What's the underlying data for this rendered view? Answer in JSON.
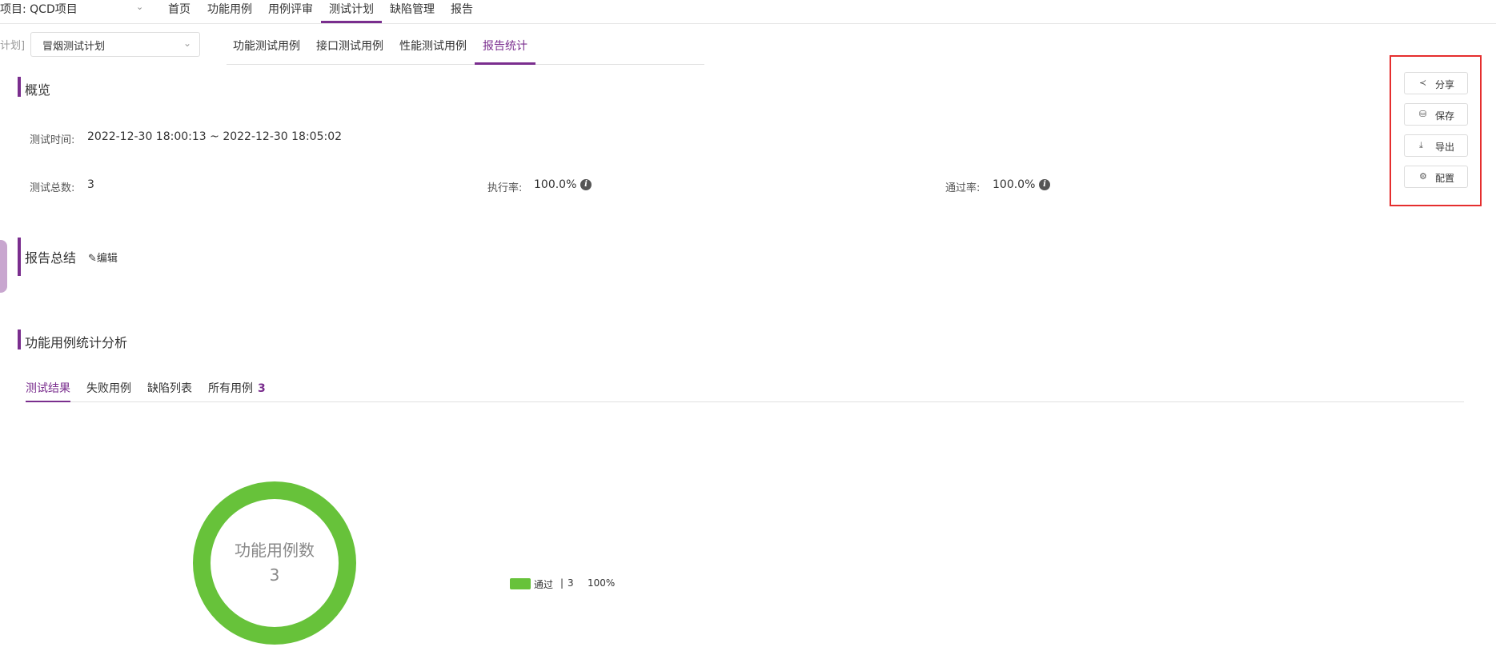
{
  "header": {
    "project_label": "项目: QCD项目",
    "nav": [
      "首页",
      "功能用例",
      "用例评审",
      "测试计划",
      "缺陷管理",
      "报告"
    ],
    "active_nav": "测试计划"
  },
  "plan_bar": {
    "label": "计划]",
    "select_value": "冒烟测试计划",
    "tabs": [
      "功能测试用例",
      "接口测试用例",
      "性能测试用例",
      "报告统计"
    ],
    "active_tab": "报告统计"
  },
  "overview": {
    "title": "概览",
    "test_time_label": "测试时间:",
    "test_time_value": "2022-12-30 18:00:13 ~ 2022-12-30 18:05:02",
    "total_label": "测试总数:",
    "total_value": "3",
    "exec_rate_label": "执行率:",
    "exec_rate_value": "100.0%",
    "pass_rate_label": "通过率:",
    "pass_rate_value": "100.0%"
  },
  "summary": {
    "title": "报告总结",
    "edit_label": "编辑"
  },
  "analysis": {
    "title": "功能用例统计分析",
    "tabs": [
      "测试结果",
      "失败用例",
      "缺陷列表",
      "所有用例"
    ],
    "all_count": "3"
  },
  "actions": {
    "share": "分享",
    "save": "保存",
    "export": "导出",
    "config": "配置"
  },
  "chart_data": {
    "type": "pie",
    "title": "功能用例数",
    "total": "3",
    "slices": [
      {
        "name": "通过",
        "value": 3,
        "percent": "100%",
        "color": "#67c23a"
      }
    ]
  },
  "colors": {
    "accent": "#7a2e8e",
    "pass": "#67c23a",
    "highlight": "#e52e2e"
  }
}
